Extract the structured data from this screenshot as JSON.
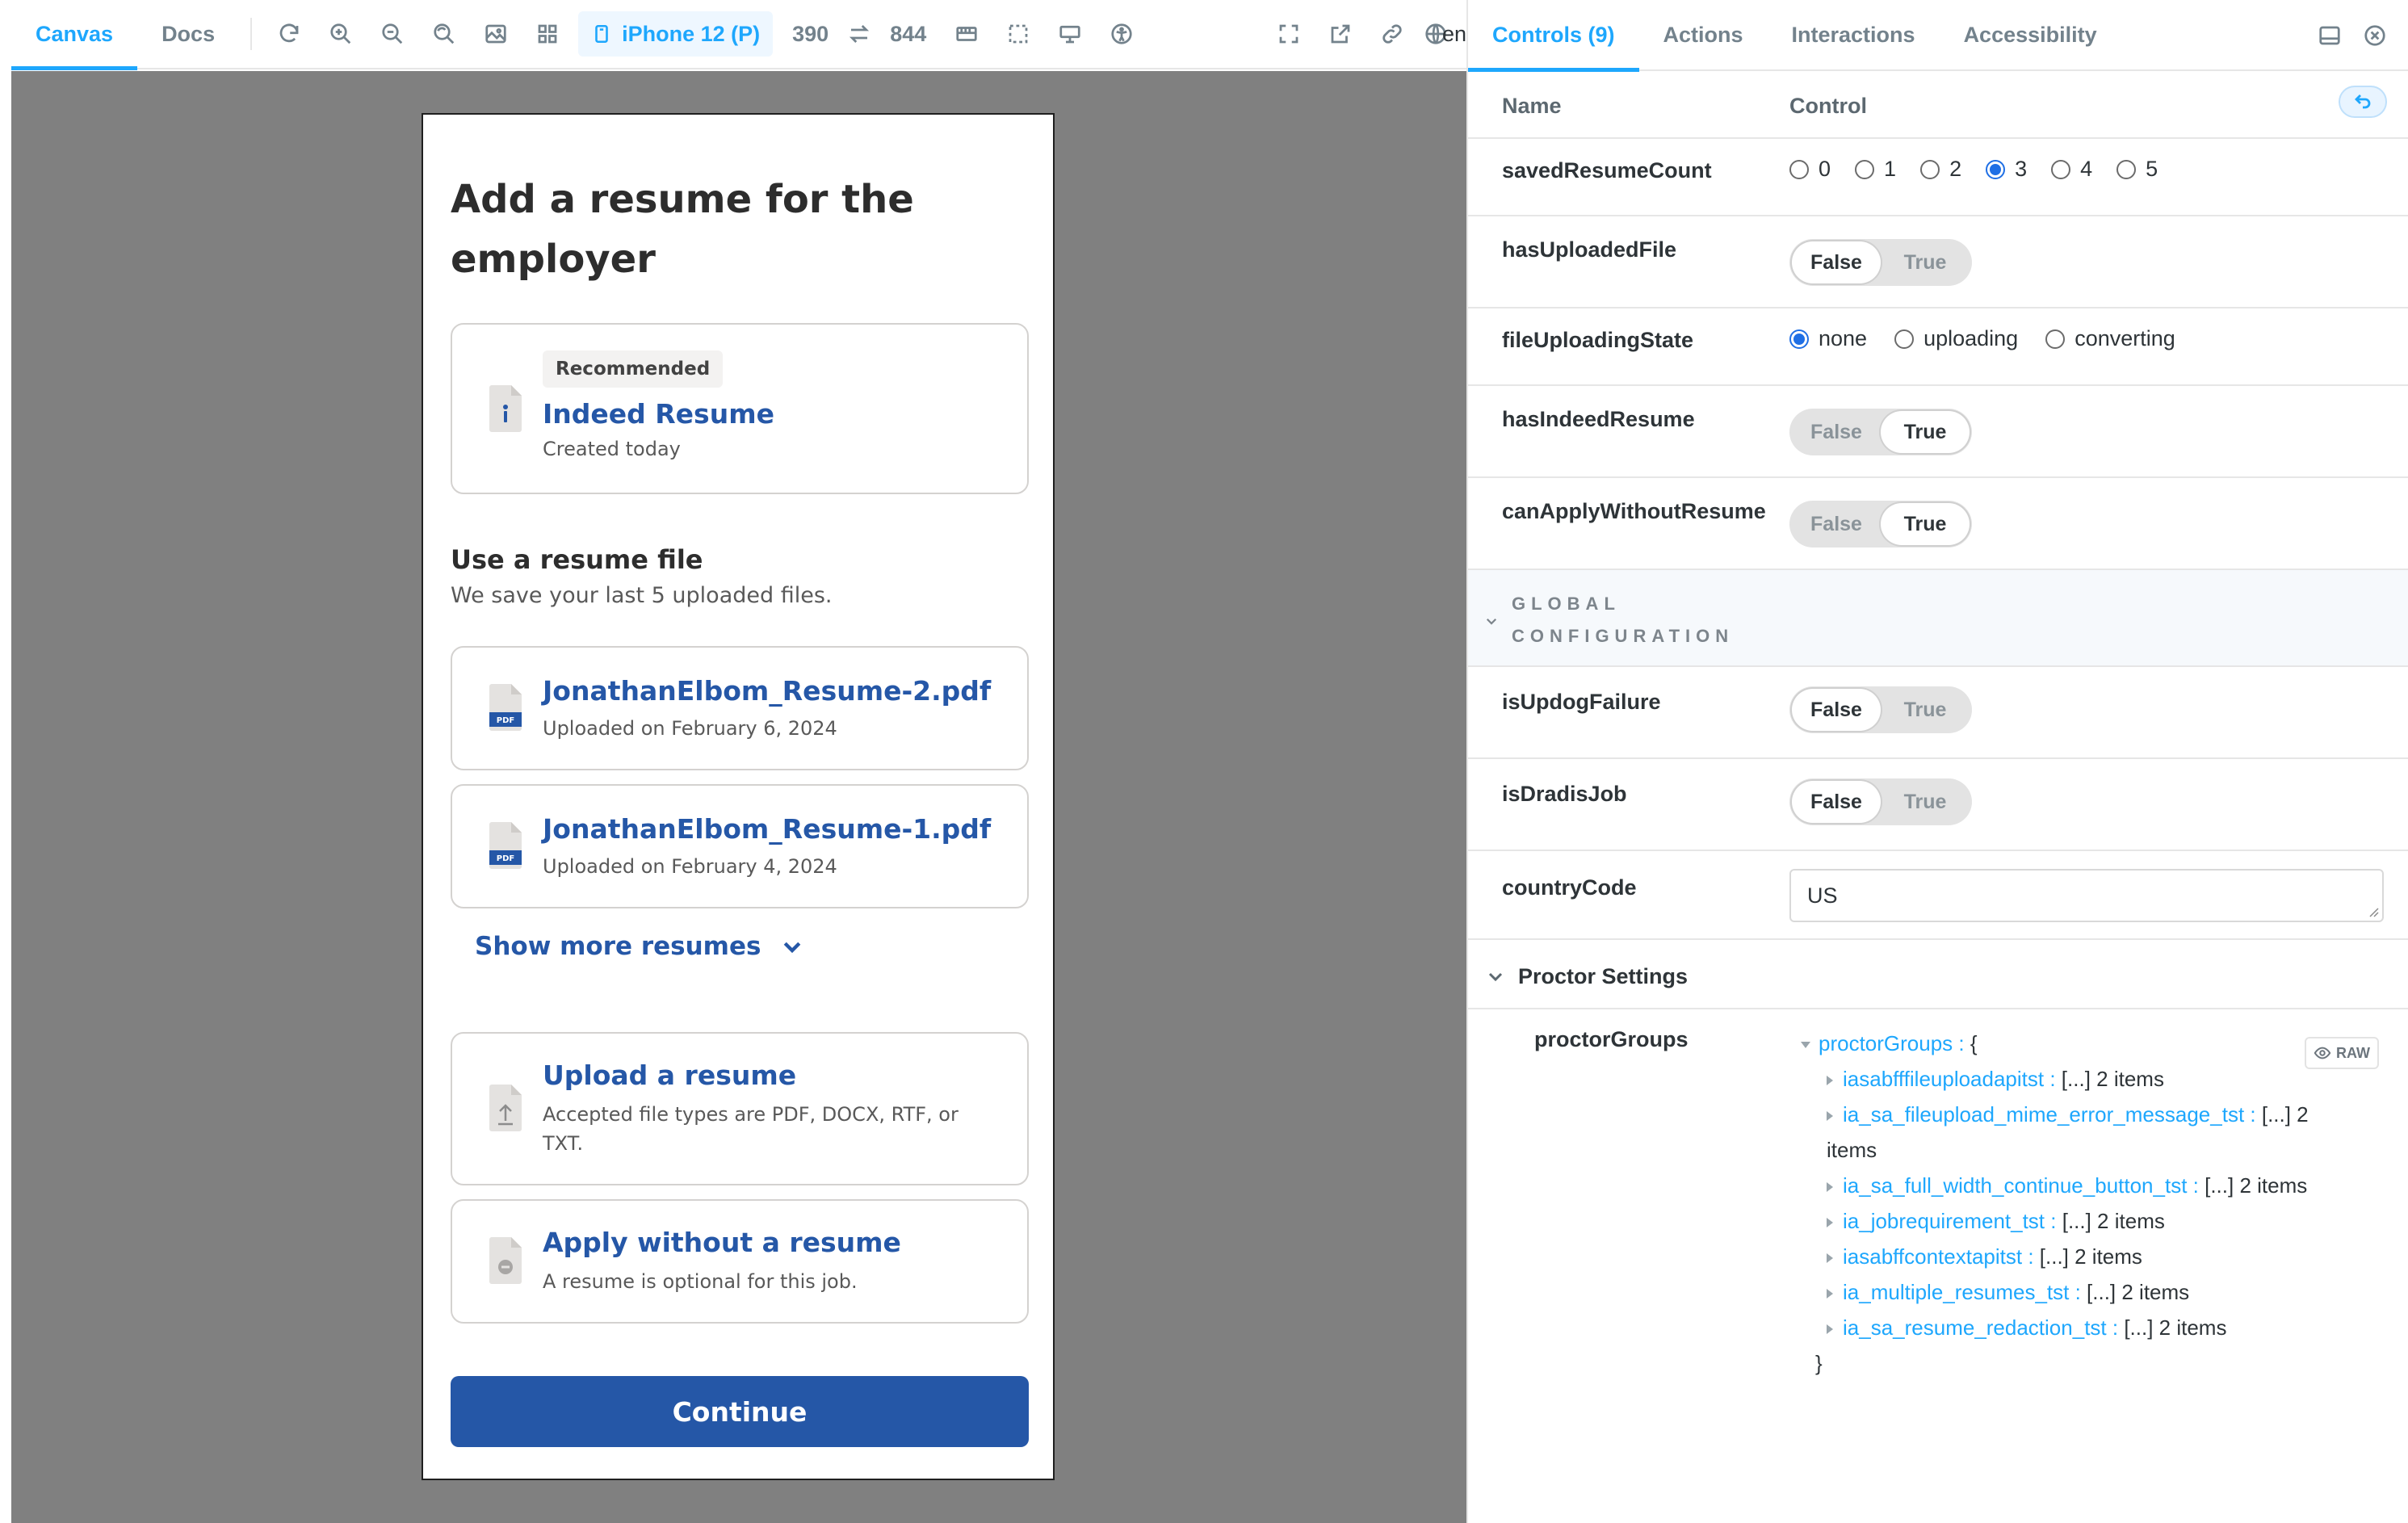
{
  "toolbar": {
    "tabs": [
      "Canvas",
      "Docs"
    ],
    "device": "iPhone 12 (P)",
    "width": "390",
    "height": "844",
    "locale": "en"
  },
  "story": {
    "title": "Add a resume for the employer",
    "indeed": {
      "badge": "Recommended",
      "title": "Indeed Resume",
      "sub": "Created today"
    },
    "file_section": {
      "title": "Use a resume file",
      "sub": "We save your last 5 uploaded files."
    },
    "files": [
      {
        "name": "JonathanElbom_Resume-2.pdf",
        "date": "Uploaded on February 6, 2024",
        "badge": "PDF"
      },
      {
        "name": "JonathanElbom_Resume-1.pdf",
        "date": "Uploaded on February 4, 2024",
        "badge": "PDF"
      }
    ],
    "show_more": "Show more resumes",
    "upload": {
      "title": "Upload a resume",
      "sub": "Accepted file types are PDF, DOCX, RTF, or TXT."
    },
    "no_resume": {
      "title": "Apply without a resume",
      "sub": "A resume is optional for this job."
    },
    "continue": "Continue"
  },
  "panel": {
    "tabs": [
      "Controls (9)",
      "Actions",
      "Interactions",
      "Accessibility"
    ],
    "header": {
      "name": "Name",
      "control": "Control"
    },
    "controls": {
      "savedResumeCount": {
        "name": "savedResumeCount",
        "options": [
          "0",
          "1",
          "2",
          "3",
          "4",
          "5"
        ],
        "selected": "3"
      },
      "hasUploadedFile": {
        "name": "hasUploadedFile",
        "value": false
      },
      "fileUploadingState": {
        "name": "fileUploadingState",
        "options": [
          "none",
          "uploading",
          "converting"
        ],
        "selected": "none"
      },
      "hasIndeedResume": {
        "name": "hasIndeedResume",
        "value": true
      },
      "canApplyWithoutResume": {
        "name": "canApplyWithoutResume",
        "value": true
      },
      "isUpdogFailure": {
        "name": "isUpdogFailure",
        "value": false
      },
      "isDradisJob": {
        "name": "isDradisJob",
        "value": false
      },
      "countryCode": {
        "name": "countryCode",
        "value": "US"
      }
    },
    "toggle_labels": {
      "false": "False",
      "true": "True"
    },
    "global_section": "GLOBAL CONFIGURATION",
    "proctor_section": "Proctor Settings",
    "proctor_groups": {
      "name": "proctorGroups",
      "root_key": "proctorGroups",
      "raw": "RAW",
      "entries": [
        {
          "key": "iasabfffileuploadapitst",
          "value": "[...] 2 items"
        },
        {
          "key": "ia_sa_fileupload_mime_error_message_tst",
          "value": "[...] 2 items"
        },
        {
          "key": "ia_sa_full_width_continue_button_tst",
          "value": "[...] 2 items"
        },
        {
          "key": "ia_jobrequirement_tst",
          "value": "[...] 2 items"
        },
        {
          "key": "iasabffcontextapitst",
          "value": "[...] 2 items"
        },
        {
          "key": "ia_multiple_resumes_tst",
          "value": "[...] 2 items"
        },
        {
          "key": "ia_sa_resume_redaction_tst",
          "value": "[...] 2 items"
        }
      ]
    }
  },
  "colors": {
    "accent": "#1ea7fd",
    "indeed_blue": "#2557a7",
    "canvas_bg": "#808080"
  }
}
